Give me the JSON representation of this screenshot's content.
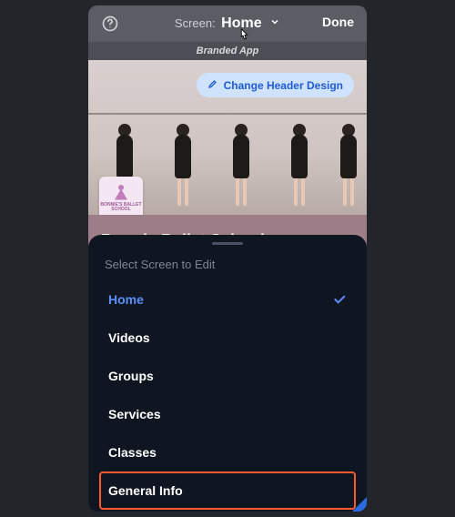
{
  "topbar": {
    "label_prefix": "Screen:",
    "current_screen": "Home",
    "done_label": "Done"
  },
  "badge": "Branded App",
  "header": {
    "change_label": "Change Header Design",
    "logo_text": "BONNIE'S BALLET SCHOOL"
  },
  "app_title": "Bonnie Ballet School",
  "sheet": {
    "title": "Select Screen to Edit",
    "items": [
      {
        "label": "Home",
        "selected": true
      },
      {
        "label": "Videos",
        "selected": false
      },
      {
        "label": "Groups",
        "selected": false
      },
      {
        "label": "Services",
        "selected": false
      },
      {
        "label": "Classes",
        "selected": false
      },
      {
        "label": "General Info",
        "selected": false,
        "highlight": true
      }
    ]
  }
}
